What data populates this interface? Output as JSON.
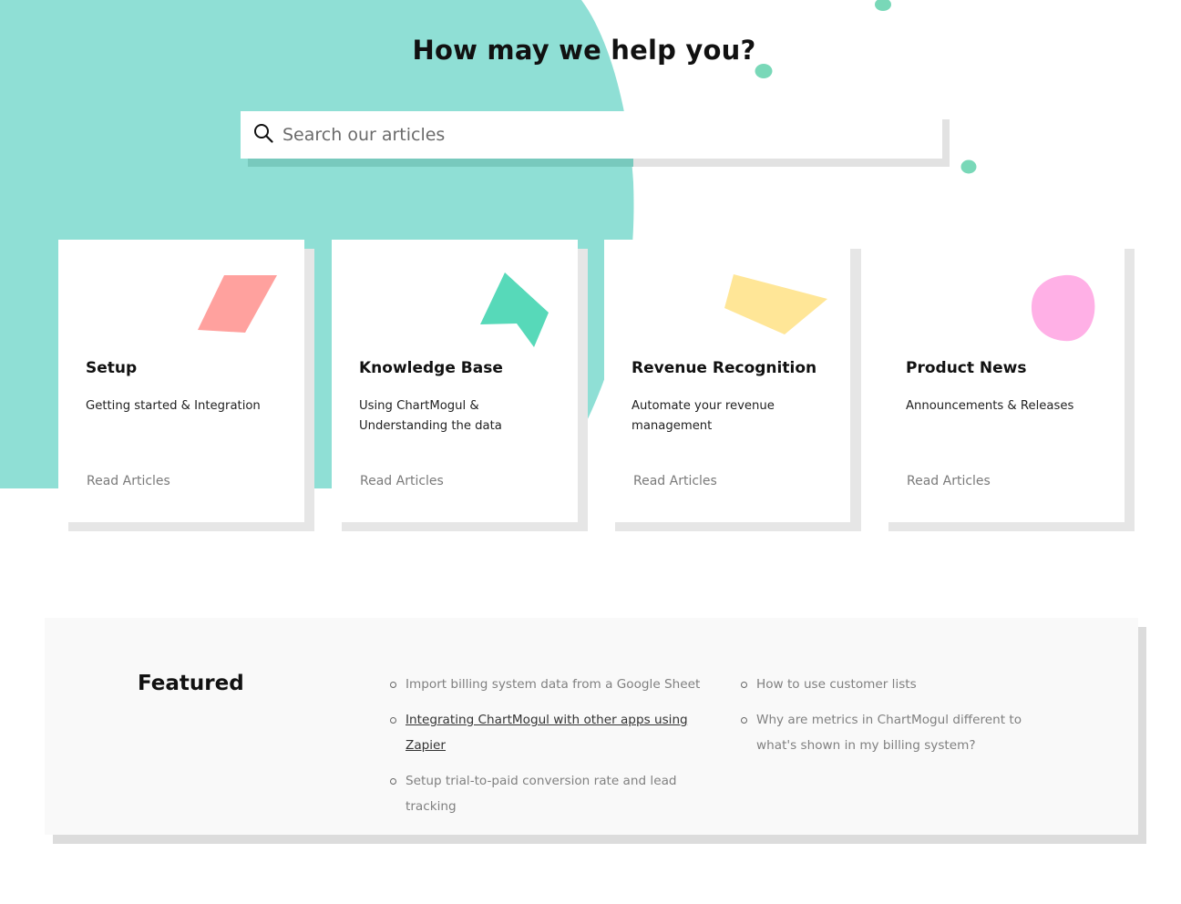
{
  "hero": {
    "title": "How may we help you?"
  },
  "search": {
    "placeholder": "Search our articles",
    "value": ""
  },
  "colors": {
    "teal_background": "#8fdfd5",
    "teal_shadow": "#78c9bd",
    "setup_shape": "#ffa19e",
    "knowledge_shape": "#57d9b9",
    "revenue_shape": "#ffe697",
    "news_shape": "#ffb0e6",
    "dots": "#79d8b8"
  },
  "categories": [
    {
      "title": "Setup",
      "description": "Getting started & Integration",
      "link": "Read Articles",
      "icon": "parallelogram-icon"
    },
    {
      "title": "Knowledge Base",
      "description": "Using ChartMogul & Understanding the data",
      "link": "Read Articles",
      "icon": "arrow-shape-icon"
    },
    {
      "title": "Revenue Recognition",
      "description": "Automate your revenue management",
      "link": "Read Articles",
      "icon": "quadrilateral-icon"
    },
    {
      "title": "Product News",
      "description": "Announcements & Releases",
      "link": "Read Articles",
      "icon": "blob-icon"
    }
  ],
  "featured": {
    "title": "Featured",
    "left_items": [
      "Import billing system data from a Google Sheet",
      "Integrating ChartMogul with other apps using Zapier",
      "Setup trial-to-paid conversion rate and lead tracking"
    ],
    "right_items": [
      "How to use customer lists",
      "Why are metrics in ChartMogul different to what's shown in my billing system?"
    ]
  }
}
